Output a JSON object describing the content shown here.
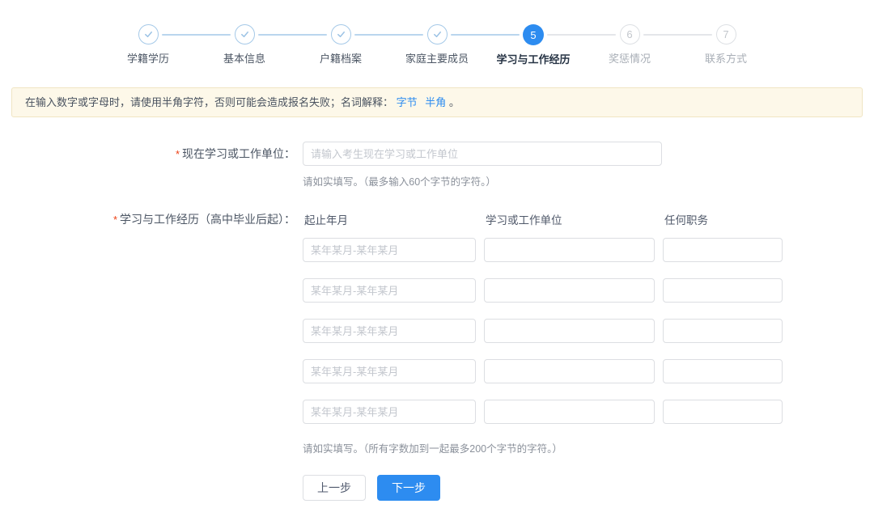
{
  "stepper": {
    "steps": [
      {
        "number": "1",
        "label": "学籍学历",
        "status": "done"
      },
      {
        "number": "2",
        "label": "基本信息",
        "status": "done"
      },
      {
        "number": "3",
        "label": "户籍档案",
        "status": "done"
      },
      {
        "number": "4",
        "label": "家庭主要成员",
        "status": "done"
      },
      {
        "number": "5",
        "label": "学习与工作经历",
        "status": "active"
      },
      {
        "number": "6",
        "label": "奖惩情况",
        "status": "waiting"
      },
      {
        "number": "7",
        "label": "联系方式",
        "status": "waiting"
      }
    ]
  },
  "notice": {
    "prefix": "在输入数字或字母时，请使用半角字符，否则可能会造成报名失败；名词解释：",
    "link1": "字节",
    "link2": "半角",
    "suffix": "。"
  },
  "form": {
    "current_unit": {
      "required_mark": "*",
      "label": "现在学习或工作单位：",
      "placeholder": "请输入考生现在学习或工作单位",
      "value": "",
      "help": "请如实填写。（最多输入60个字节的字符。）"
    },
    "experience": {
      "required_mark": "*",
      "label": "学习与工作经历（高中毕业后起）：",
      "columns": [
        "起止年月",
        "学习或工作单位",
        "任何职务"
      ],
      "rows": [
        {
          "period_placeholder": "某年某月-某年某月",
          "unit_value": "",
          "duty_value": ""
        },
        {
          "period_placeholder": "某年某月-某年某月",
          "unit_value": "",
          "duty_value": ""
        },
        {
          "period_placeholder": "某年某月-某年某月",
          "unit_value": "",
          "duty_value": ""
        },
        {
          "period_placeholder": "某年某月-某年某月",
          "unit_value": "",
          "duty_value": ""
        },
        {
          "period_placeholder": "某年某月-某年某月",
          "unit_value": "",
          "duty_value": ""
        }
      ],
      "help": "请如实填写。（所有字数加到一起最多200个字节的字符。）"
    },
    "buttons": {
      "prev": "上一步",
      "next": "下一步"
    }
  },
  "colors": {
    "primary": "#2d8cf0",
    "step_done_border": "#a5c9e8",
    "notice_bg": "#fdf8e9",
    "notice_border": "#f0e5c3",
    "required_mark": "#ed4014"
  }
}
